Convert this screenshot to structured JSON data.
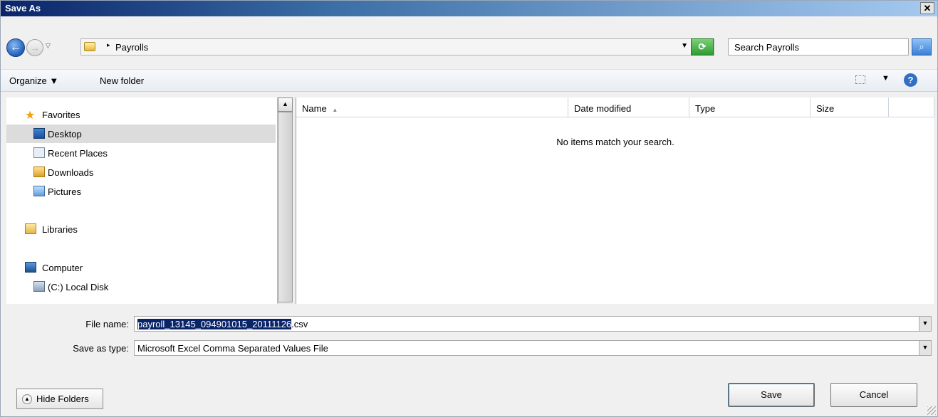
{
  "window": {
    "title": "Save As",
    "close_glyph": "✕"
  },
  "address": {
    "path_arrow": "▸",
    "path_segment": "Payrolls",
    "dropdown_glyph": "▼",
    "refresh_icon": "refresh-icon"
  },
  "search": {
    "placeholder": "Search Payrolls"
  },
  "toolbar": {
    "organize_label": "Organize ▼",
    "new_folder_label": "New folder",
    "view_drop_glyph": "▼",
    "help_glyph": "?"
  },
  "nav_pane": {
    "favorites_label": "Favorites",
    "items": [
      {
        "label": "Desktop",
        "icon": "desktop-icon"
      },
      {
        "label": "Recent Places",
        "icon": "recent-places-icon"
      },
      {
        "label": "Downloads",
        "icon": "downloads-icon"
      },
      {
        "label": "Pictures",
        "icon": "pictures-icon"
      }
    ],
    "libraries_label": "Libraries",
    "computer_label": "Computer",
    "local_disk_label": "(C:) Local Disk"
  },
  "file_list": {
    "columns": {
      "name": "Name",
      "sort_glyph": "▲",
      "date_modified": "Date modified",
      "type": "Type",
      "size": "Size"
    },
    "empty_message": "No items match your search."
  },
  "form": {
    "file_name_label": "File name:",
    "file_name_selected": "payroll_13145_094901015_20111126",
    "file_name_ext": ".csv",
    "save_type_label": "Save as type:",
    "save_type_value": "Microsoft Excel Comma Separated Values File"
  },
  "buttons": {
    "hide_folders": "Hide Folders",
    "save": "Save",
    "cancel": "Cancel"
  },
  "colors": {
    "title_start": "#0a246a",
    "title_end": "#a6caf0",
    "selection": "#0a246a"
  }
}
